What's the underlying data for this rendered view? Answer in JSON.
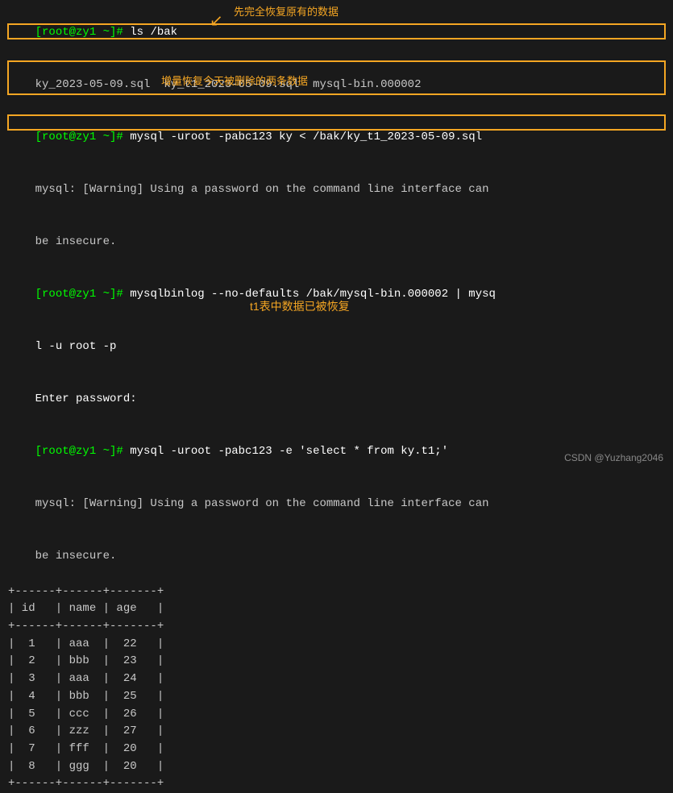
{
  "terminal": {
    "lines": [
      {
        "type": "prompt",
        "prompt": "[root@zy1 ~]# ",
        "cmd": "ls /bak"
      },
      {
        "type": "output",
        "text": "ky_2023-05-09.sql  ky_t1_2023-05-09.sql  mysql-bin.000002"
      },
      {
        "type": "prompt_cmd",
        "prompt": "[root@zy1 ~]# ",
        "cmd": "mysql -uroot -pabc123 ky < /bak/ky_t1_2023-05-09.sql"
      },
      {
        "type": "output",
        "text": "mysql: [Warning] Using a password on the command line interface can"
      },
      {
        "type": "output",
        "text": "be insecure."
      },
      {
        "type": "prompt_cmd",
        "prompt": "[root@zy1 ~]# ",
        "cmd": "mysqlbinlog --no-defaults /bak/mysql-bin.000002 | mysq"
      },
      {
        "type": "output",
        "text": "l -u root -p"
      },
      {
        "type": "output",
        "text": "Enter password:"
      },
      {
        "type": "prompt_cmd",
        "prompt": "[root@zy1 ~]# ",
        "cmd": "mysql -uroot -pabc123 -e 'select * from ky.t1;'"
      },
      {
        "type": "output",
        "text": "mysql: [Warning] Using a password on the command line interface can"
      },
      {
        "type": "output",
        "text": "be insecure."
      },
      {
        "type": "table",
        "text": "+------+------+-------+"
      },
      {
        "type": "table",
        "text": "| id   | name | age   |"
      },
      {
        "type": "table",
        "text": "+------+------+-------+"
      },
      {
        "type": "table",
        "text": "|  1   | aaa  |  22   |"
      },
      {
        "type": "table",
        "text": "|  2   | bbb  |  23   |"
      },
      {
        "type": "table",
        "text": "|  3   | aaa  |  24   |"
      },
      {
        "type": "table",
        "text": "|  4   | bbb  |  25   |"
      },
      {
        "type": "table",
        "text": "|  5   | ccc  |  26   |"
      },
      {
        "type": "table",
        "text": "|  6   | zzz  |  27   |"
      },
      {
        "type": "table",
        "text": "|  7   | fff  |  20   |"
      },
      {
        "type": "table",
        "text": "|  8   | ggg  |  20   |"
      },
      {
        "type": "table",
        "text": "+------+------+-------+"
      }
    ],
    "annotation1": "先完全恢复原有的数据",
    "annotation2": "增量恢复今天被删除的两条数据",
    "annotation3": "t1表中数据已被恢复",
    "watermark": "CSDN @Yuzhang2046"
  }
}
